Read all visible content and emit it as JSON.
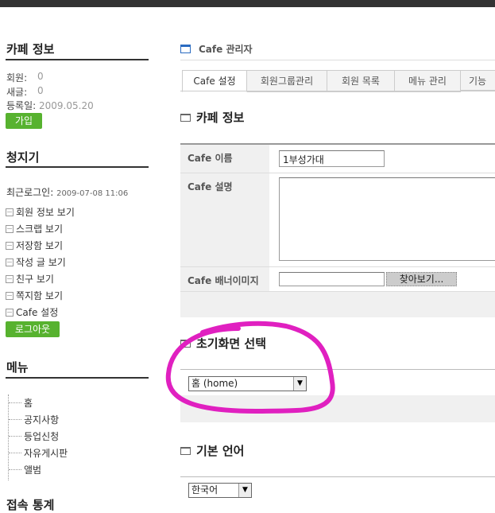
{
  "sidebar": {
    "cafe_info": {
      "title": "카페 정보",
      "members_label": "회원:",
      "members_value": "0",
      "new_label": "새글:",
      "new_value": "0",
      "reg_label": "등록일:",
      "reg_value": "2009.05.20",
      "join_button": "가입"
    },
    "user": {
      "name": "청지기",
      "last_login_label": "최근로그인:",
      "last_login_value": "2009-07-08 11:06",
      "links": [
        "회원 정보 보기",
        "스크랩 보기",
        "저장함 보기",
        "작성 글 보기",
        "친구 보기",
        "쪽지함 보기",
        "Cafe 설정"
      ],
      "logout_button": "로그아웃"
    },
    "menu": {
      "title": "메뉴",
      "items": [
        "홈",
        "공지사항",
        "등업신청",
        "자유게시판",
        "앨범"
      ]
    },
    "next_section_title": "접속 통계"
  },
  "main": {
    "admin_title": "Cafe 관리자",
    "tabs": [
      "Cafe 설정",
      "회원그룹관리",
      "회원 목록",
      "메뉴 관리",
      "기능"
    ],
    "cafe_section_title": "카페 정보",
    "form": {
      "name_label": "Cafe 이름",
      "name_value": "1부성가대",
      "desc_label": "Cafe 설명",
      "desc_value": "",
      "banner_label": "Cafe 배너이미지",
      "banner_value": "",
      "browse_button": "찾아보기..."
    },
    "start_section_title": "초기화면 선택",
    "start_select": "홈 (home)",
    "lang_section_title": "기본 언어",
    "lang_select": "한국어"
  },
  "colors": {
    "accent_green": "#57b22f",
    "annotation_magenta": "#e020c0",
    "admin_icon_blue": "#2a6bc1"
  }
}
